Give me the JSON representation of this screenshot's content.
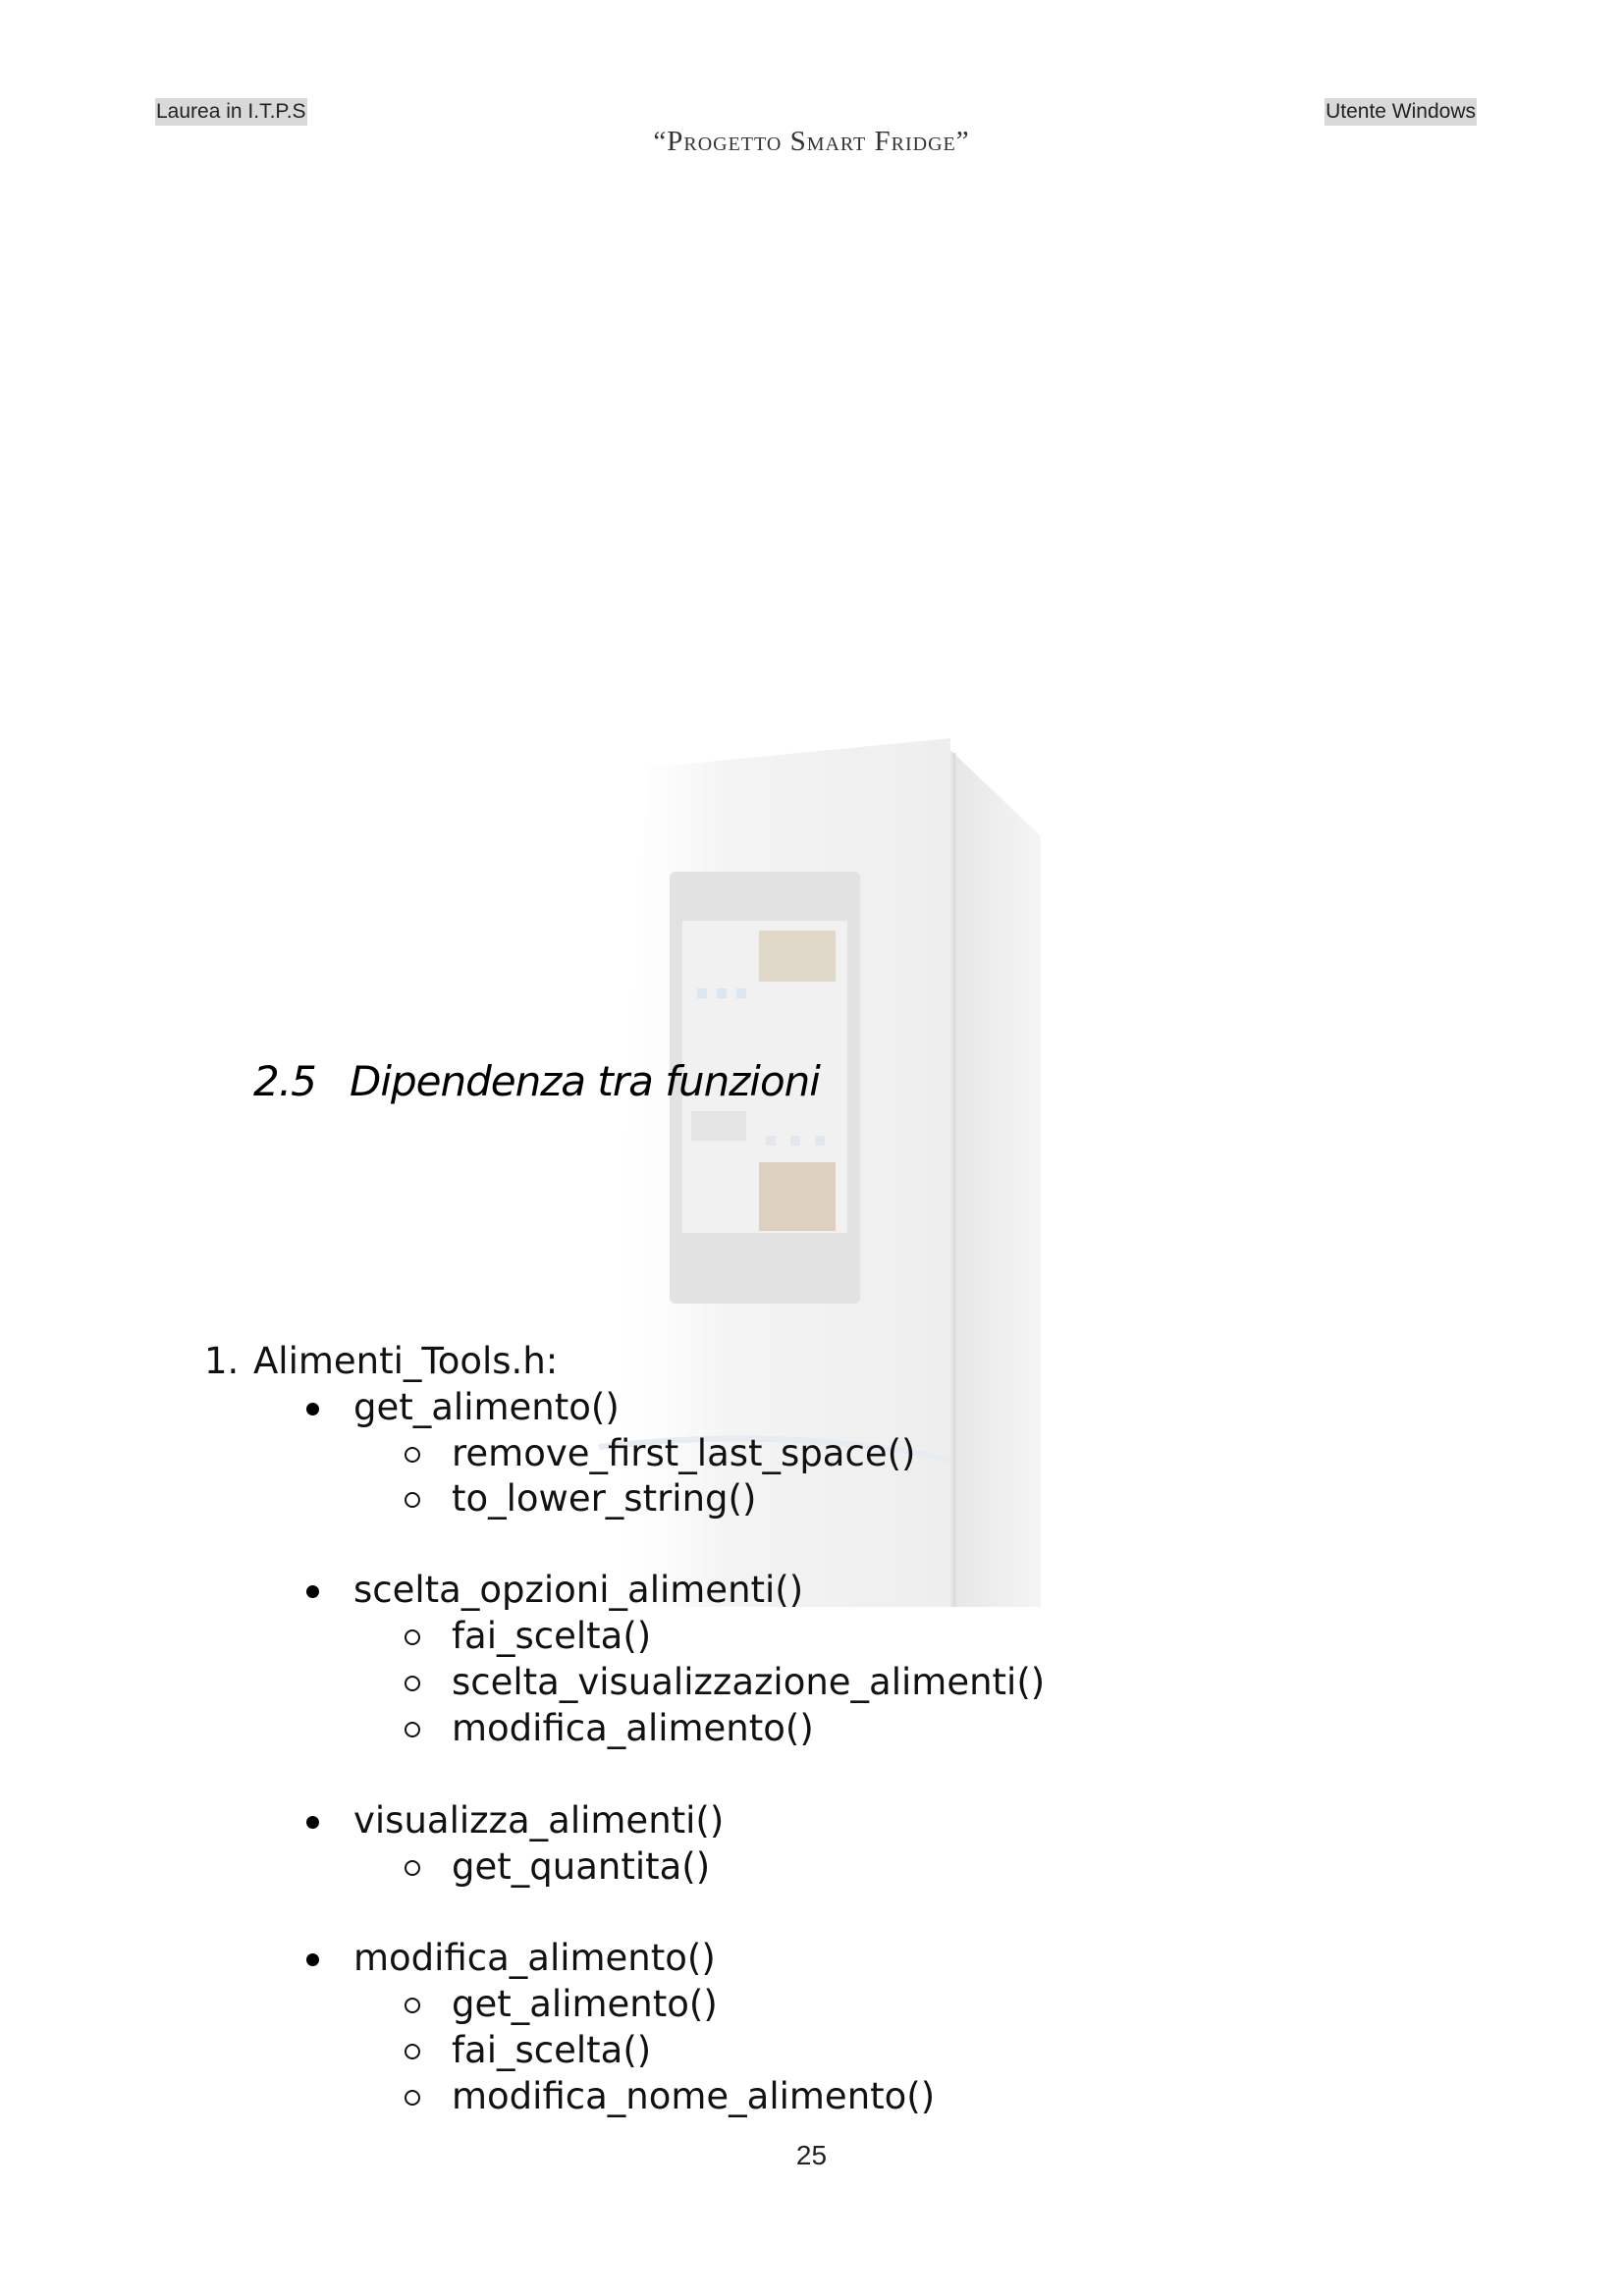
{
  "header": {
    "left": "Laurea in I.T.P.S",
    "center": "“Progetto Smart Fridge”",
    "right": "Utente Windows"
  },
  "section": {
    "number": "2.5",
    "title": "Dipendenza tra funzioni"
  },
  "list": {
    "item1": {
      "marker": "1.",
      "label": "Alimenti_Tools.h:",
      "functions": [
        {
          "name": "get_alimento()",
          "calls": [
            "remove_first_last_space()",
            "to_lower_string()"
          ]
        },
        {
          "name": "scelta_opzioni_alimenti()",
          "calls": [
            "fai_scelta()",
            "scelta_visualizzazione_alimenti()",
            "modifica_alimento()"
          ]
        },
        {
          "name": "visualizza_alimenti()",
          "calls": [
            "get_quantita()"
          ]
        },
        {
          "name": "modifica_alimento()",
          "calls": [
            "get_alimento()",
            "fai_scelta()",
            "modifica_nome_alimento()"
          ]
        }
      ]
    }
  },
  "page_number": "25"
}
